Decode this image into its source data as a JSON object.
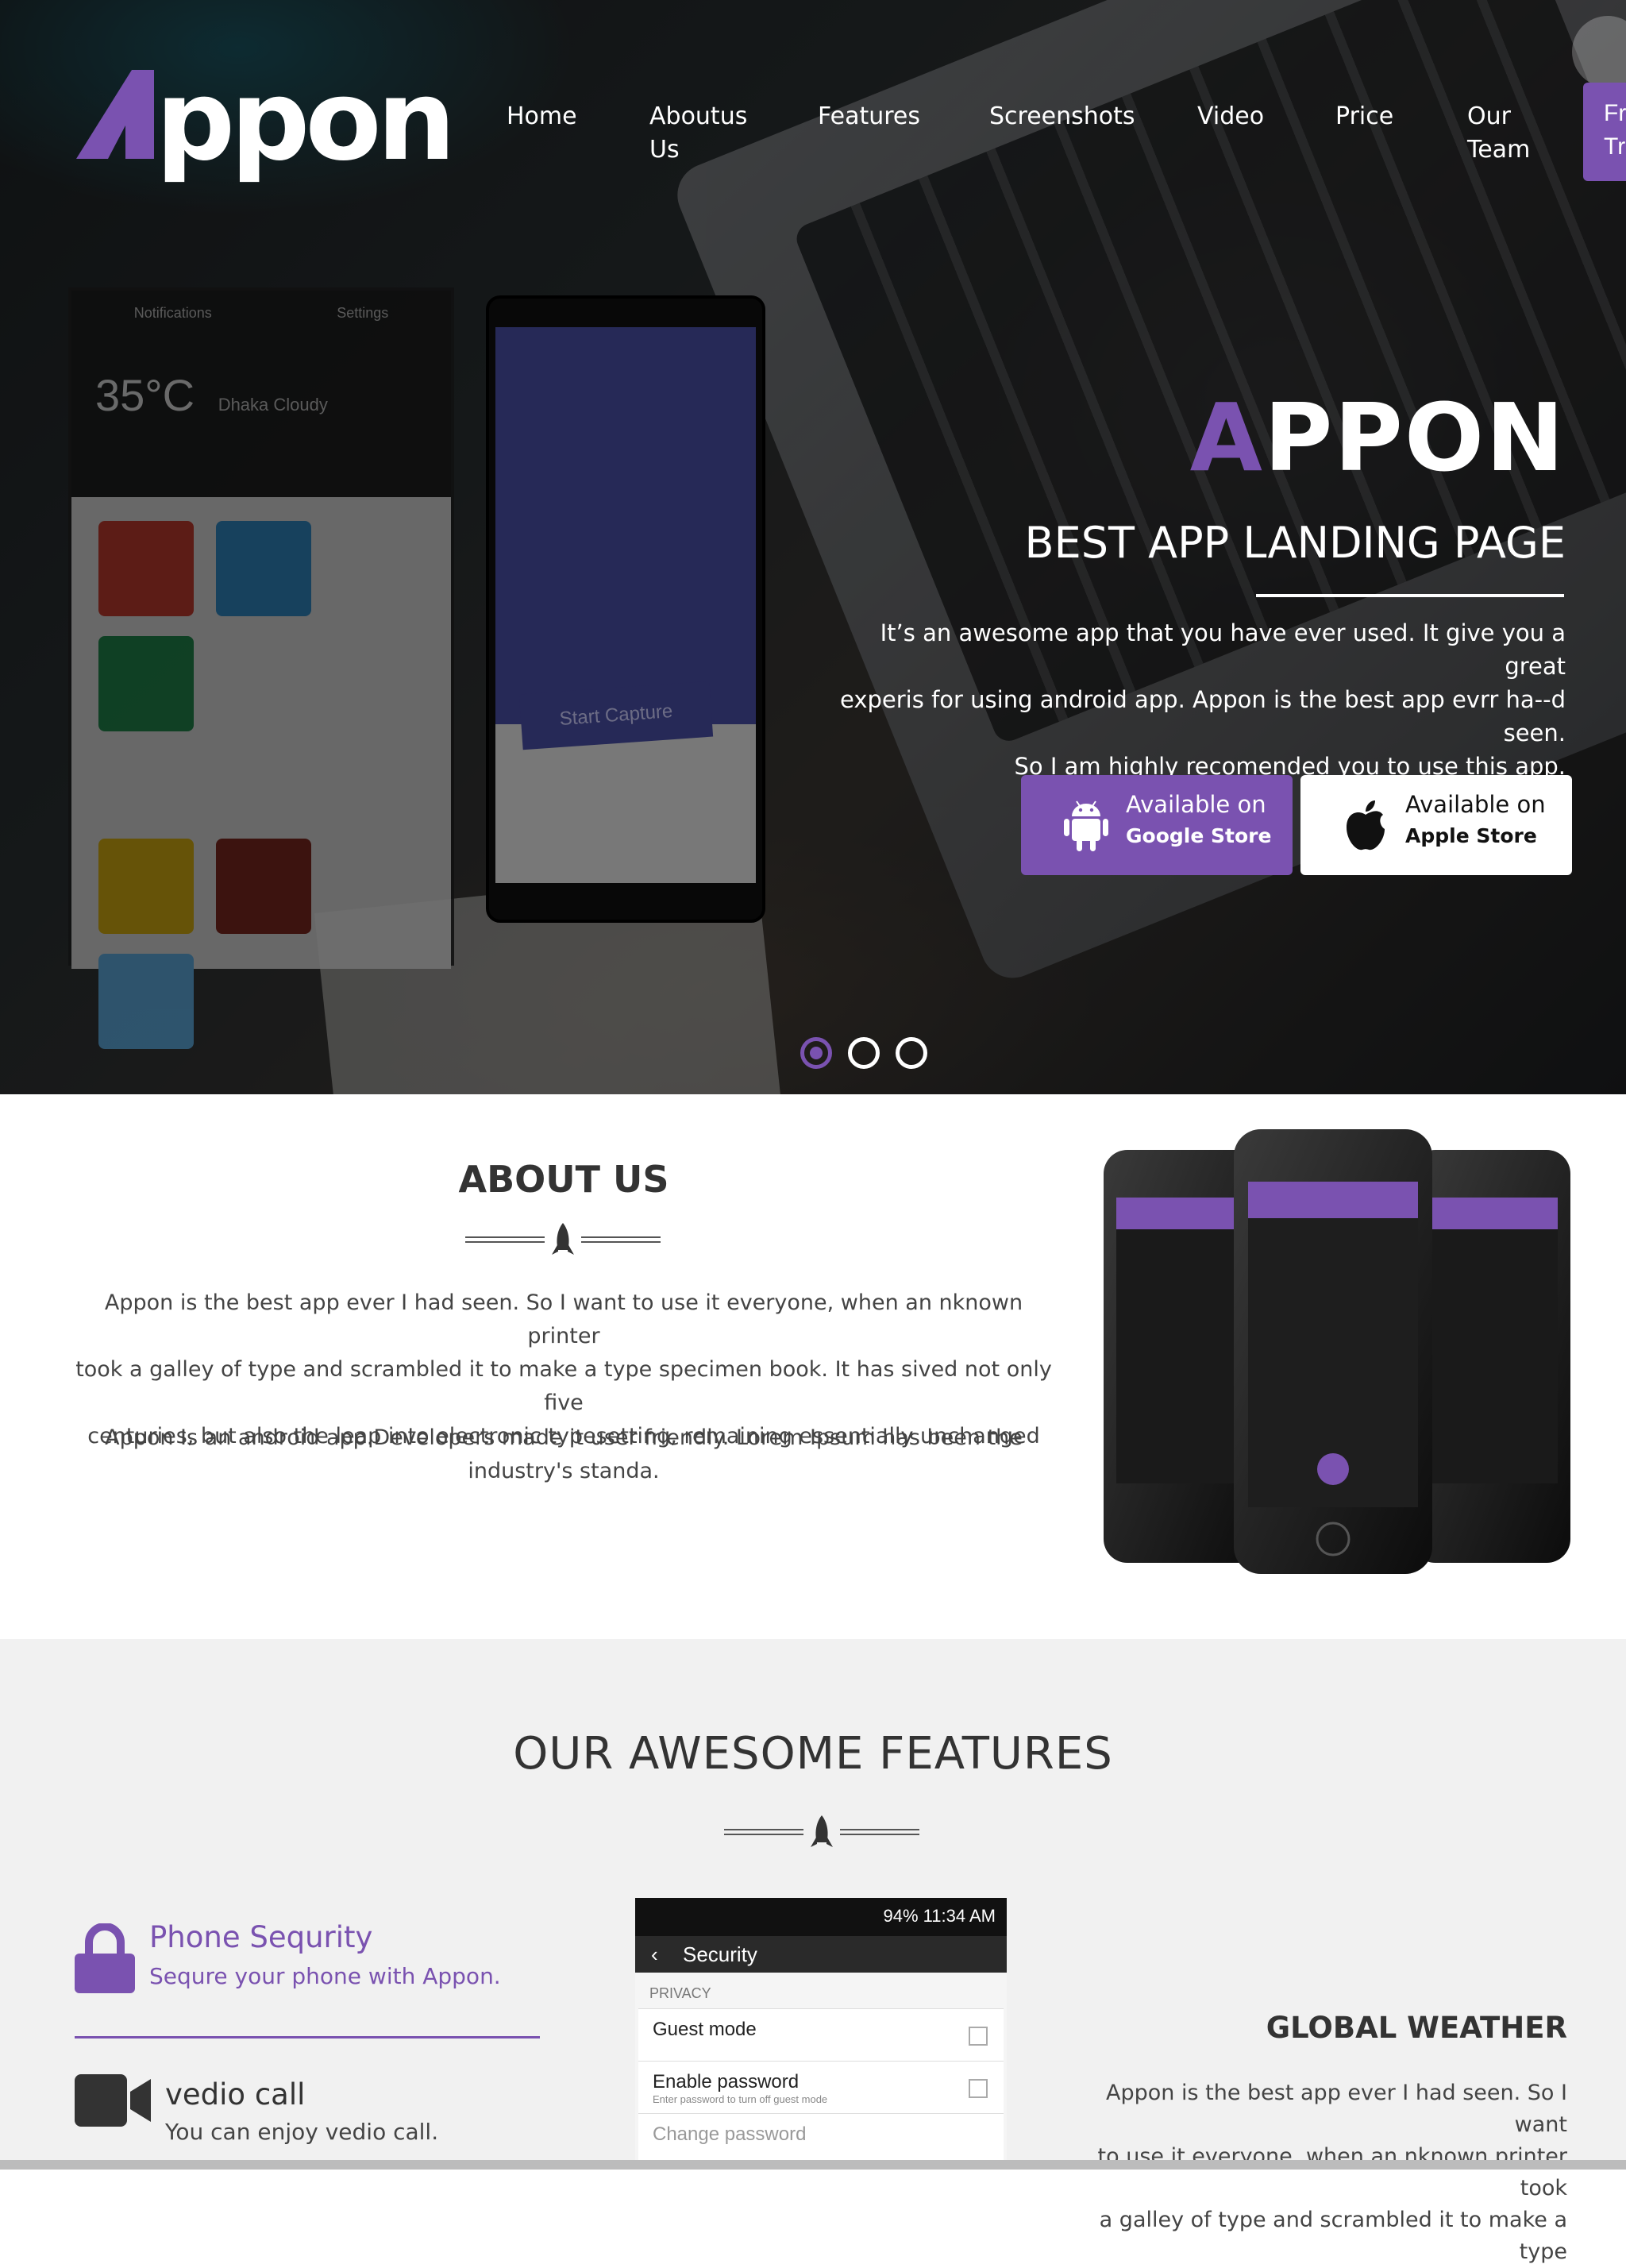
{
  "brand": {
    "logo_text": "Appon",
    "accent": "#7a52b0"
  },
  "nav": {
    "items": [
      "Home",
      "Aboutus Us",
      "Features",
      "Screenshots",
      "Video",
      "Price",
      "Our Team"
    ],
    "cta": "Fr Tr"
  },
  "hero": {
    "title_first": "A",
    "title_rest": "PPON",
    "subtitle": "BEST APP LANDING PAGE",
    "text_1": "It’s an awesome app that you have ever used. It give you a great",
    "text_2": "experis for using android app. Appon is the best app evrr ha--d seen.",
    "text_3": "So I am highly recomended you to use this app.",
    "google_btn": {
      "line1": "Available on",
      "line2": "Google Store"
    },
    "apple_btn": {
      "line1": "Available on",
      "line2": "Apple Store"
    },
    "phone_mockup": {
      "tab_notifications": "Notifications",
      "tab_settings": "Settings",
      "temperature": "35°C",
      "weather": "Dhaka Cloudy",
      "button": "Start Capture"
    },
    "slides": 3,
    "active_slide": 1
  },
  "about": {
    "title": "ABOUT US",
    "para1_l1": "Appon is the best app ever I had seen. So I want to use it everyone, when an nknown printer",
    "para1_l2": "took a galley of type and scrambled it to make a type specimen book. It has sived not only five",
    "para1_l3": "centuries, but also the leap into electronic typesetting, remaining essentially unchanged",
    "para2_l1": "Appon Is an android app.Developers made it user friendly. Lorem Ipsum has been the",
    "para2_l2": "industry's standa."
  },
  "features": {
    "title": "OUR AWESOME FEATURES",
    "items": [
      {
        "name": "Phone Sequrity",
        "desc": "Sequre your phone with Appon.",
        "icon": "lock-icon",
        "color": "#7a52b0"
      },
      {
        "name": "vedio call",
        "desc": "You can enjoy vedio call.",
        "icon": "video-camera-icon",
        "color": "#333333"
      }
    ],
    "screenshot": {
      "status": "94%  11:34 AM",
      "header": "Security",
      "section": "PRIVACY",
      "row1": "Guest mode",
      "row2": "Enable password",
      "row2_sub": "Enter password to turn off guest mode",
      "row3": "Change password"
    },
    "weather": {
      "title": "GLOBAL WEATHER",
      "line1": "Appon is the best app ever I had seen. So I want",
      "line2": "to use it everyone, when an nknown printer took",
      "line3": "a galley of type and scrambled it to make a type"
    }
  }
}
